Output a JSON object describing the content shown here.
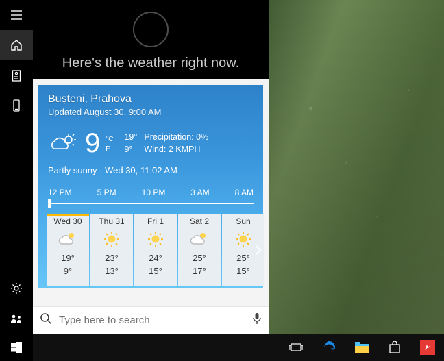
{
  "cortana": {
    "prompt": "Here's the weather right now."
  },
  "weather": {
    "location": "Bușteni, Prahova",
    "updated": "Updated August 30, 9:00 AM",
    "temp": "9",
    "unit_c": "°C",
    "unit_f": "F",
    "high": "19°",
    "low": "9°",
    "precip_label": "Precipitation: 0%",
    "wind_label": "Wind: 2 KMPH",
    "condition_line": "Partly sunny  ·  Wed 30, 11:02 AM",
    "timeline": [
      "12 PM",
      "5 PM",
      "10 PM",
      "3 AM",
      "8 AM"
    ],
    "daily": [
      {
        "day": "Wed 30",
        "hi": "19°",
        "lo": "9°",
        "icon": "partly",
        "selected": true
      },
      {
        "day": "Thu 31",
        "hi": "23°",
        "lo": "13°",
        "icon": "sunny",
        "selected": false
      },
      {
        "day": "Fri 1",
        "hi": "24°",
        "lo": "15°",
        "icon": "sunny",
        "selected": false
      },
      {
        "day": "Sat 2",
        "hi": "25°",
        "lo": "17°",
        "icon": "partly",
        "selected": false
      },
      {
        "day": "Sun",
        "hi": "25°",
        "lo": "15°",
        "icon": "sunny",
        "selected": false
      }
    ]
  },
  "search": {
    "placeholder": "Type here to search"
  },
  "rail": {
    "items": [
      "menu",
      "home",
      "notebook",
      "device"
    ],
    "bottom": [
      "settings",
      "feedback"
    ]
  },
  "icons": {
    "menu": "menu-icon",
    "home": "home-icon",
    "notebook": "notebook-icon",
    "device": "device-icon",
    "settings": "gear-icon",
    "feedback": "feedback-icon",
    "search": "search-icon",
    "mic": "mic-icon",
    "start": "windows-icon",
    "taskview": "taskview-icon",
    "edge": "edge-icon",
    "explorer": "explorer-icon",
    "store": "store-icon",
    "app": "app-icon",
    "chevron": "chevron-right-icon"
  },
  "colors": {
    "edge": "#1e88e5",
    "explorer_tab": "#ffcf48",
    "store_bag": "#ffffff",
    "app_red": "#e53935"
  }
}
